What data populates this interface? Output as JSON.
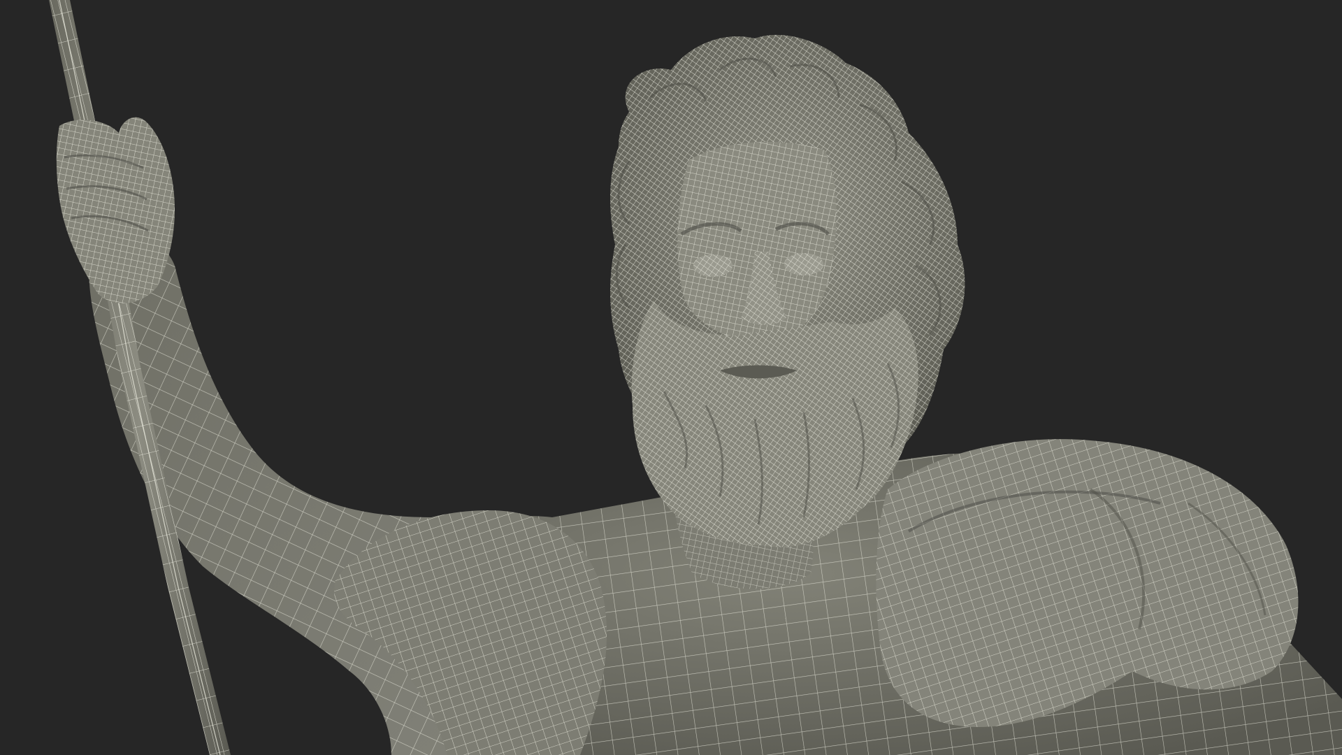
{
  "scene": {
    "subject": "wireframe-statue-bearded-figure-with-staff",
    "colors": {
      "background": "#262626",
      "surface": "#77776c",
      "surface_dark": "#5e5e55",
      "surface_light": "#8b8b80",
      "wire": "#e8e8dc"
    }
  }
}
